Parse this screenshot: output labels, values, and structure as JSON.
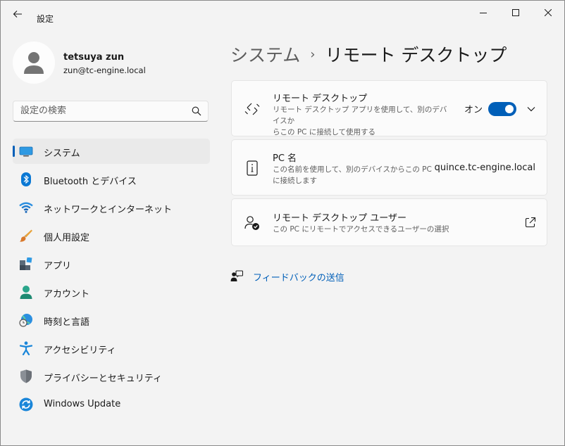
{
  "app": {
    "title": "設定"
  },
  "user": {
    "name": "tetsuya zun",
    "email": "zun@tc-engine.local"
  },
  "search": {
    "placeholder": "設定の検索"
  },
  "nav": {
    "items": [
      {
        "label": "システム",
        "icon": "system-monitor-icon",
        "selected": true
      },
      {
        "label": "Bluetooth とデバイス",
        "icon": "bluetooth-icon"
      },
      {
        "label": "ネットワークとインターネット",
        "icon": "wifi-icon"
      },
      {
        "label": "個人用設定",
        "icon": "brush-icon"
      },
      {
        "label": "アプリ",
        "icon": "apps-icon"
      },
      {
        "label": "アカウント",
        "icon": "account-icon"
      },
      {
        "label": "時刻と言語",
        "icon": "time-language-icon"
      },
      {
        "label": "アクセシビリティ",
        "icon": "accessibility-icon"
      },
      {
        "label": "プライバシーとセキュリティ",
        "icon": "shield-icon"
      },
      {
        "label": "Windows Update",
        "icon": "update-icon"
      }
    ]
  },
  "breadcrumb": {
    "parent": "システム",
    "separator": "›",
    "current": "リモート デスクトップ"
  },
  "cards": {
    "remote_desktop": {
      "title": "リモート デスクトップ",
      "desc_line1": "リモート デスクトップ アプリを使用して、別のデバイスか",
      "desc_line2": "らこの PC に接続して使用する",
      "toggle_label": "オン",
      "toggle_on": true
    },
    "pc_name": {
      "title": "PC 名",
      "desc_line1": "この名前を使用して、別のデバイスからこの PC",
      "desc_line2": "に接続します",
      "value": "quince.tc-engine.local"
    },
    "users": {
      "title": "リモート デスクトップ ユーザー",
      "desc": "この PC にリモートでアクセスできるユーザーの選択"
    }
  },
  "feedback": {
    "label": "フィードバックの送信"
  },
  "colors": {
    "accent": "#005fb8",
    "background": "#f3f3f3",
    "card": "#fbfbfb"
  }
}
